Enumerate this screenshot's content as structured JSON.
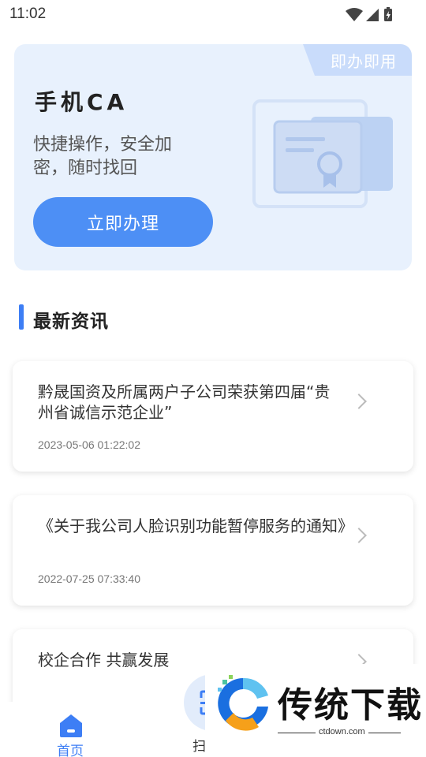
{
  "status_bar": {
    "time": "11:02",
    "icons": [
      "wifi-icon",
      "signal-icon",
      "battery-charging-icon"
    ]
  },
  "banner": {
    "tag": "即办即用",
    "title": "手机CA",
    "description": "快捷操作，安全加密，随时找回",
    "button_label": "立即办理",
    "illustration": "certificate-icon"
  },
  "news_section": {
    "title": "最新资讯",
    "items": [
      {
        "title": "黔晟国资及所属两户子公司荣获第四届“贵州省诚信示范企业”",
        "date": "2023-05-06 01:22:02"
      },
      {
        "title": "《关于我公司人脸识别功能暂停服务的通知》",
        "date": "2022-07-25 07:33:40"
      },
      {
        "title": "校企合作 共赢发展",
        "date": ""
      }
    ]
  },
  "bottom_nav": {
    "home_label": "首页",
    "scan_label": "扫"
  },
  "watermark": {
    "text": "传统下载",
    "url": "ctdown.com"
  },
  "colors": {
    "accent": "#4d8ff5",
    "banner_bg": "#e8f1fd",
    "tag_bg": "#c9dcfb"
  }
}
